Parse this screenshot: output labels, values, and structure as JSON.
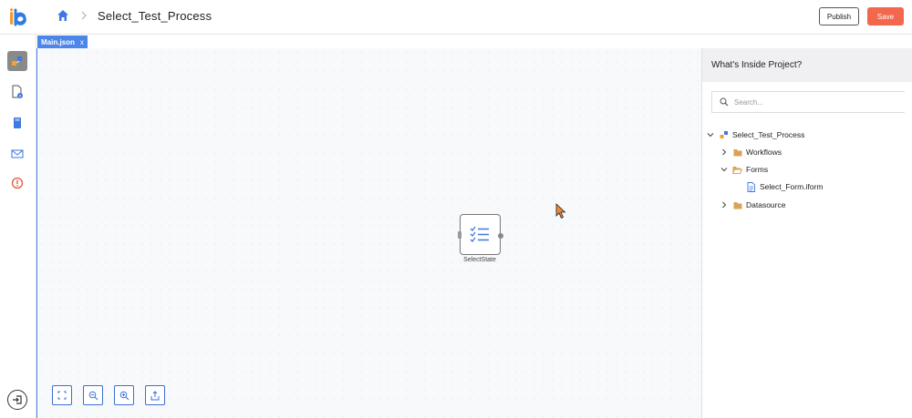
{
  "header": {
    "title": "Select_Test_Process",
    "publish_label": "Publish",
    "save_label": "Save",
    "save_color": "#f3674d"
  },
  "left_rail": {
    "items": [
      {
        "icon": "process-icon",
        "active": true
      },
      {
        "icon": "document-info-icon"
      },
      {
        "icon": "notebook-icon"
      },
      {
        "icon": "mail-icon"
      },
      {
        "icon": "alert-circle-icon"
      }
    ],
    "collapse_icon": "exit-panel-icon"
  },
  "tabs": [
    {
      "label": "Main.json",
      "close": "x",
      "active": true
    }
  ],
  "canvas": {
    "node": {
      "label": "SelectState",
      "icon": "checklist-icon"
    },
    "tools": [
      "fit-screen-icon",
      "zoom-out-icon",
      "zoom-in-icon",
      "export-icon"
    ]
  },
  "panel": {
    "title": "What's Inside Project?",
    "search_placeholder": "Search...",
    "tree": [
      {
        "label": "Select_Test_Process",
        "icon": "process-icon",
        "expanded": true,
        "level": 0
      },
      {
        "label": "Workflows",
        "icon": "folder-icon",
        "expanded": false,
        "level": 1
      },
      {
        "label": "Forms",
        "icon": "folder-open-icon",
        "expanded": true,
        "level": 1
      },
      {
        "label": "Select_Form.iform",
        "icon": "file-icon",
        "level": 2
      },
      {
        "label": "Datasource",
        "icon": "folder-icon",
        "expanded": false,
        "level": 1
      }
    ]
  },
  "colors": {
    "accent": "#4c86e9",
    "folder": "#d9a15a",
    "alert": "#e8553c"
  }
}
